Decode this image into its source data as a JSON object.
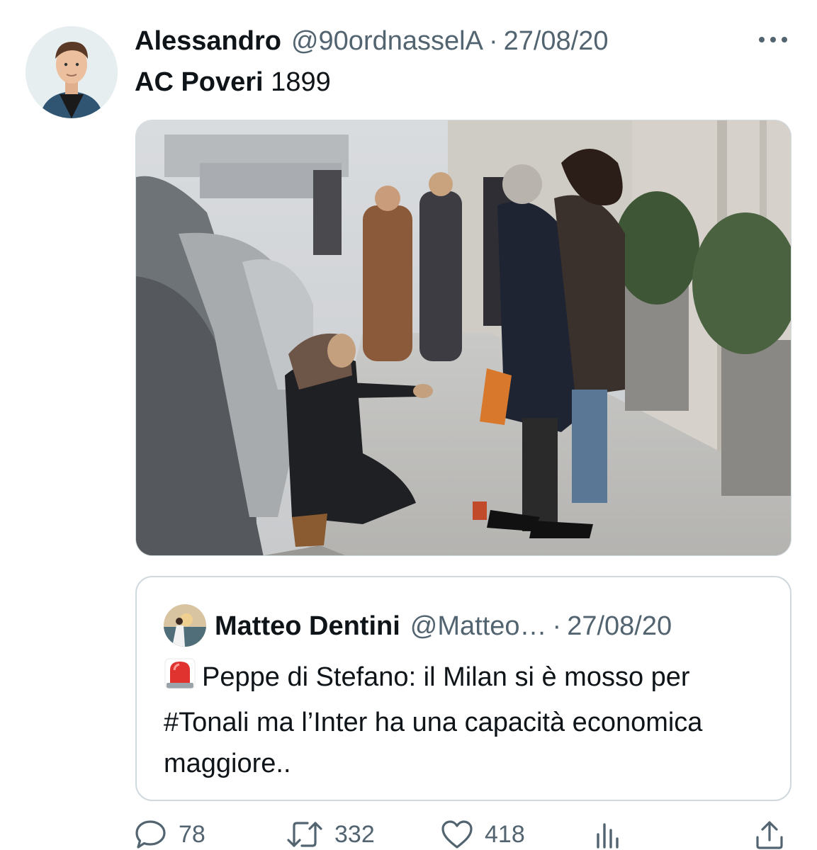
{
  "author": {
    "name": "Alessandro",
    "handle": "@90ordnasselA",
    "separator": "·",
    "date": "27/08/20"
  },
  "tweet": {
    "text_bold": "AC Poveri",
    "text_rest": " 1899"
  },
  "more_icon": "more-horizontal-icon",
  "quoted": {
    "name": "Matteo Dentini",
    "handle": "@Matteo…",
    "separator": "·",
    "date": "27/08/20",
    "emoji_icon": "police-siren-icon",
    "text": "Peppe di Stefano: il Milan si è mosso per #Tonali ma l’Inter ha una capacità economica maggiore.."
  },
  "actions": {
    "replies": "78",
    "retweets": "332",
    "likes": "418",
    "views_icon": "analytics-icon",
    "share_icon": "share-icon"
  },
  "colors": {
    "text": "#0f1419",
    "secondary": "#536471",
    "border": "#cfd9de"
  }
}
